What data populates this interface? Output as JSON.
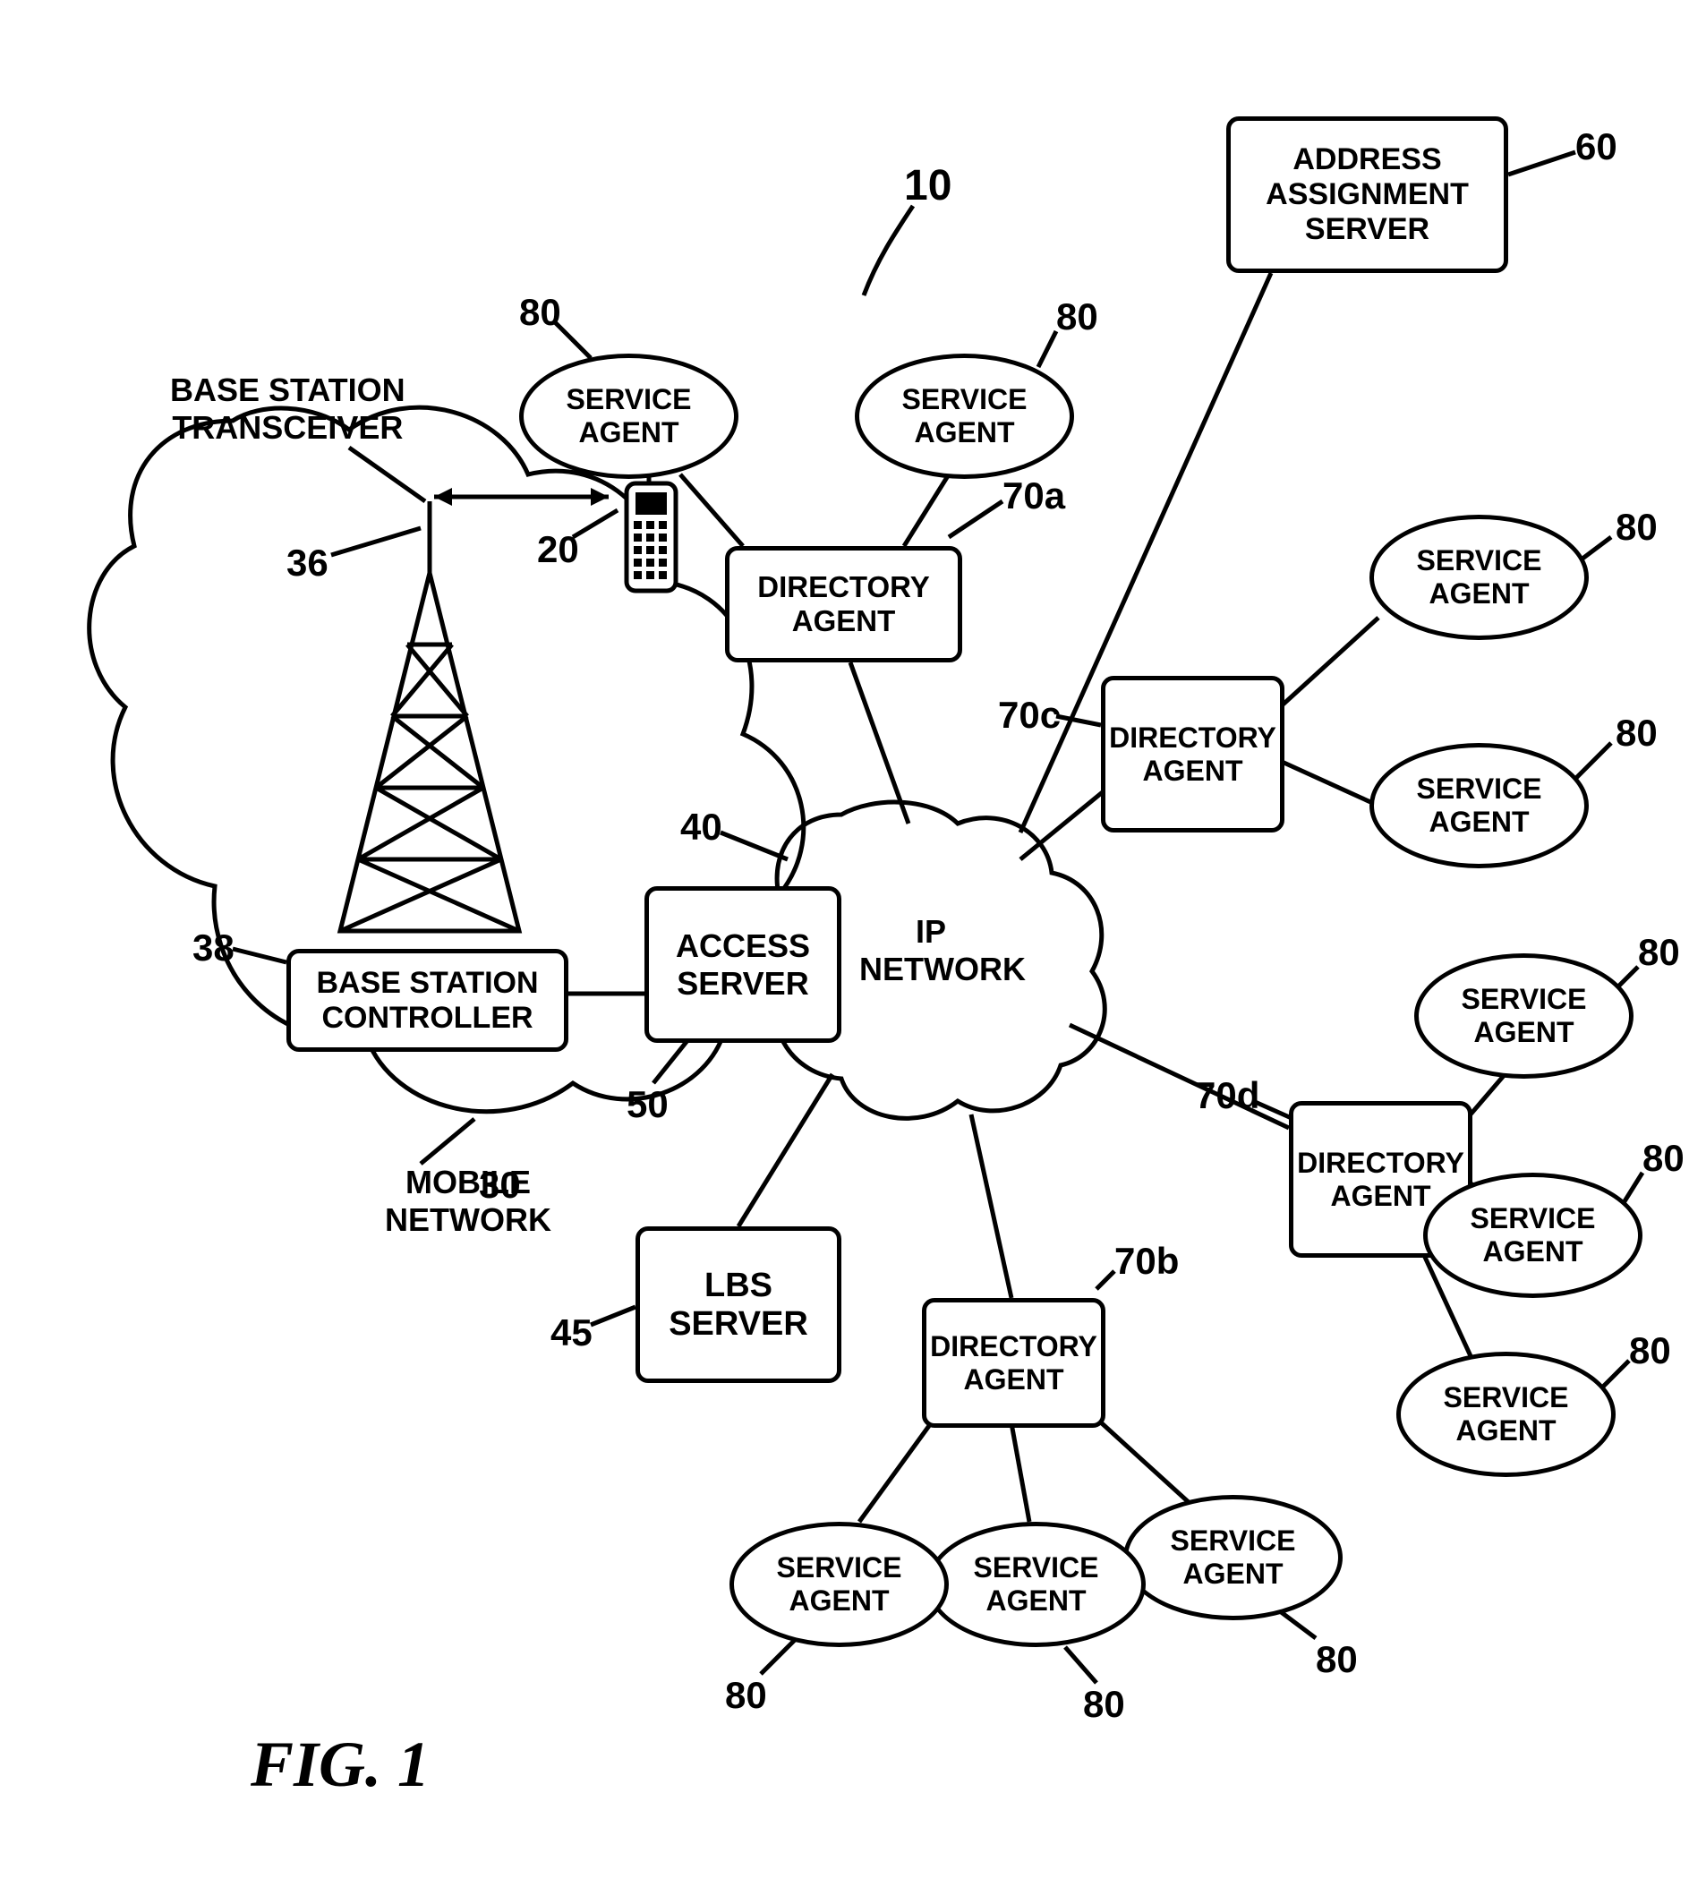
{
  "figure_label": "FIG. 1",
  "system_ref": "10",
  "mobile_network": {
    "label": "MOBILE\nNETWORK",
    "ref": "30"
  },
  "bst": {
    "label": "BASE STATION\nTRANSCEIVER",
    "ref": "36"
  },
  "bsc": {
    "label": "BASE STATION\nCONTROLLER",
    "ref": "38"
  },
  "phone_ref": "20",
  "access_server": {
    "label": "ACCESS\nSERVER",
    "ref": "50"
  },
  "lbs_server": {
    "label": "LBS\nSERVER",
    "ref": "45"
  },
  "ip_network": {
    "label": "IP\nNETWORK",
    "ref": "40"
  },
  "address_server": {
    "label": "ADDRESS\nASSIGNMENT\nSERVER",
    "ref": "60"
  },
  "directory_agents": {
    "a": {
      "label": "DIRECTORY\nAGENT",
      "ref": "70a"
    },
    "b": {
      "label": "DIRECTORY\nAGENT",
      "ref": "70b"
    },
    "c": {
      "label": "DIRECTORY\nAGENT",
      "ref": "70c"
    },
    "d": {
      "label": "DIRECTORY\nAGENT",
      "ref": "70d"
    }
  },
  "service_agent_label": "SERVICE\nAGENT",
  "service_agent_ref": "80"
}
